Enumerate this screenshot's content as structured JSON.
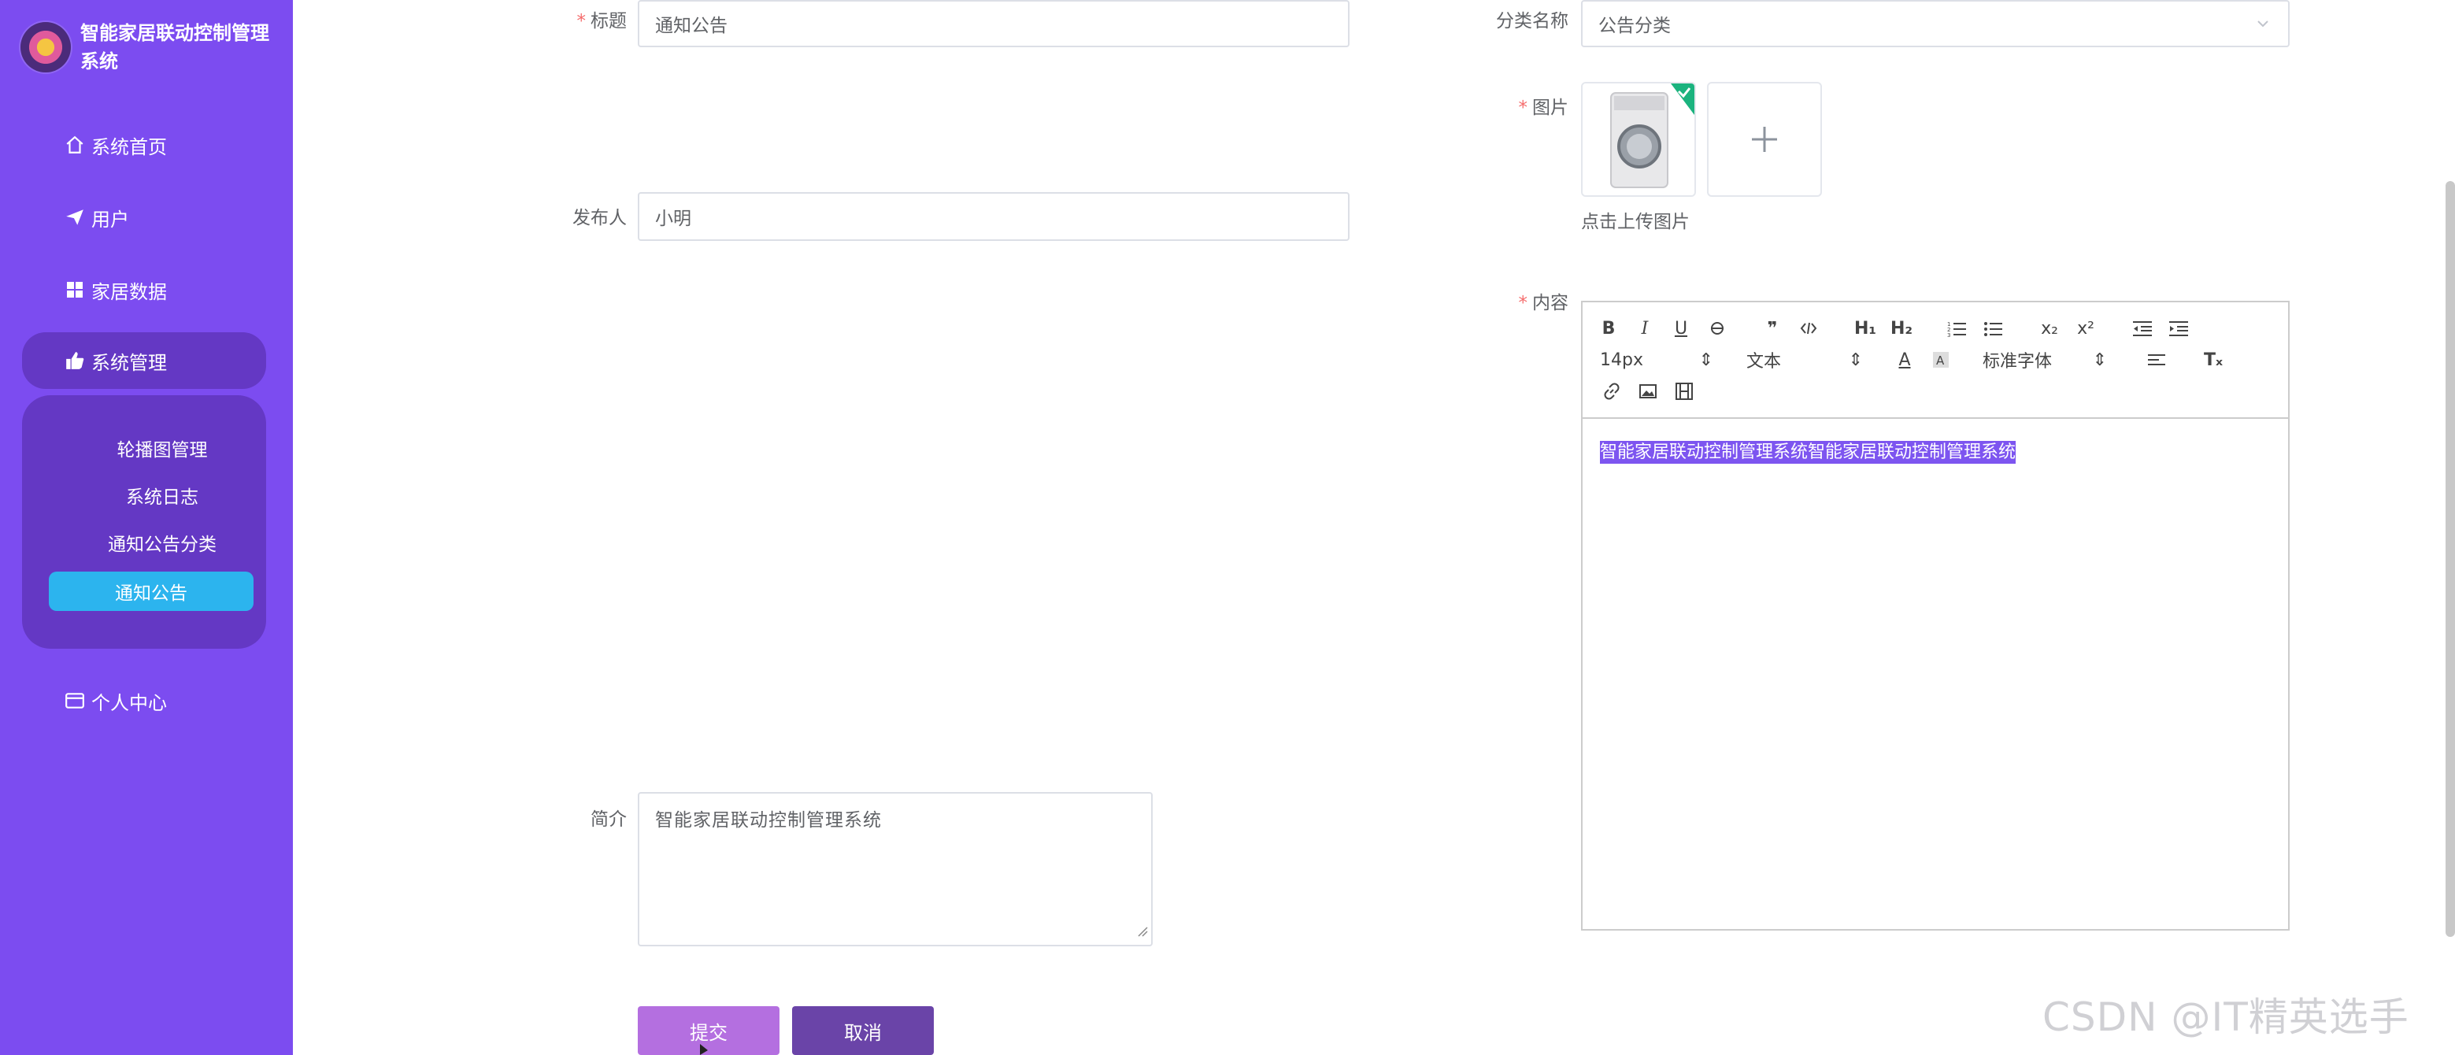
{
  "app": {
    "title": "智能家居联动控制管理系统"
  },
  "sidebar": {
    "items": [
      {
        "label": "系统首页",
        "icon": "home-icon"
      },
      {
        "label": "用户",
        "icon": "send-icon"
      },
      {
        "label": "家居数据",
        "icon": "grid-icon"
      },
      {
        "label": "系统管理",
        "icon": "thumbs-up-icon"
      },
      {
        "label": "个人中心",
        "icon": "card-icon"
      }
    ],
    "submenu": [
      {
        "label": "轮播图管理"
      },
      {
        "label": "系统日志"
      },
      {
        "label": "通知公告分类"
      },
      {
        "label": "通知公告",
        "active": true
      }
    ],
    "bg_color": "#7c4cf0",
    "active_color": "#2cb4ee"
  },
  "form": {
    "title_label": "标题",
    "title_value": "通知公告",
    "category_label": "分类名称",
    "category_value": "公告分类",
    "image_label": "图片",
    "upload_hint": "点击上传图片",
    "publisher_label": "发布人",
    "publisher_value": "小明",
    "content_label": "内容",
    "summary_label": "简介",
    "summary_value": "智能家居联动控制管理系统",
    "submit_label": "提交",
    "cancel_label": "取消"
  },
  "editor": {
    "font_size": "14px",
    "block_type": "文本",
    "font_family": "标准字体",
    "content": "智能家居联动控制管理系统智能家居联动控制管理系统"
  },
  "watermark": "CSDN @IT精英选手"
}
